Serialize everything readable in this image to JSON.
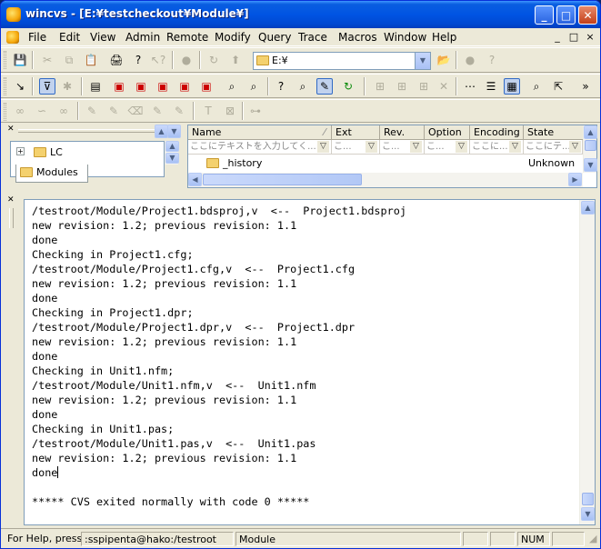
{
  "window": {
    "title": "wincvs - [E:¥testcheckout¥Module¥]",
    "minimize_icon": "minimize-icon",
    "maximize_icon": "maximize-icon",
    "close_icon": "close-icon"
  },
  "menubar": {
    "items": [
      "File",
      "Edit",
      "View",
      "Admin",
      "Remote",
      "Modify",
      "Query",
      "Trace",
      "Macros",
      "Window",
      "Help"
    ],
    "mdi_controls": [
      "_",
      "□",
      "×"
    ]
  },
  "toolbar": {
    "drive_combo_value": "E:¥"
  },
  "tree": {
    "item_label": "LC",
    "expander": "+",
    "tab_label": "Modules"
  },
  "file_list": {
    "columns": [
      "Name",
      "Ext",
      "Rev.",
      "Option",
      "Encoding",
      "State"
    ],
    "filter_placeholders": [
      "ここにテキストを入力してく...",
      "こ...",
      "こ...",
      "こ...",
      "ここに...",
      "ここにテ..."
    ],
    "rows": [
      {
        "name": "_history",
        "state": "Unknown"
      }
    ]
  },
  "output": {
    "lines": [
      "/testroot/Module/Project1.bdsproj,v  <--  Project1.bdsproj",
      "new revision: 1.2; previous revision: 1.1",
      "done",
      "Checking in Project1.cfg;",
      "/testroot/Module/Project1.cfg,v  <--  Project1.cfg",
      "new revision: 1.2; previous revision: 1.1",
      "done",
      "Checking in Project1.dpr;",
      "/testroot/Module/Project1.dpr,v  <--  Project1.dpr",
      "new revision: 1.2; previous revision: 1.1",
      "done",
      "Checking in Unit1.nfm;",
      "/testroot/Module/Unit1.nfm,v  <--  Unit1.nfm",
      "new revision: 1.2; previous revision: 1.1",
      "done",
      "Checking in Unit1.pas;",
      "/testroot/Module/Unit1.pas,v  <--  Unit1.pas",
      "new revision: 1.2; previous revision: 1.1",
      "done",
      "",
      "***** CVS exited normally with code 0 *****"
    ]
  },
  "statusbar": {
    "help_text": "For Help, press",
    "cvsroot": ":sspipenta@hako:/testroot",
    "module": "Module",
    "num_indicator": "NUM"
  }
}
